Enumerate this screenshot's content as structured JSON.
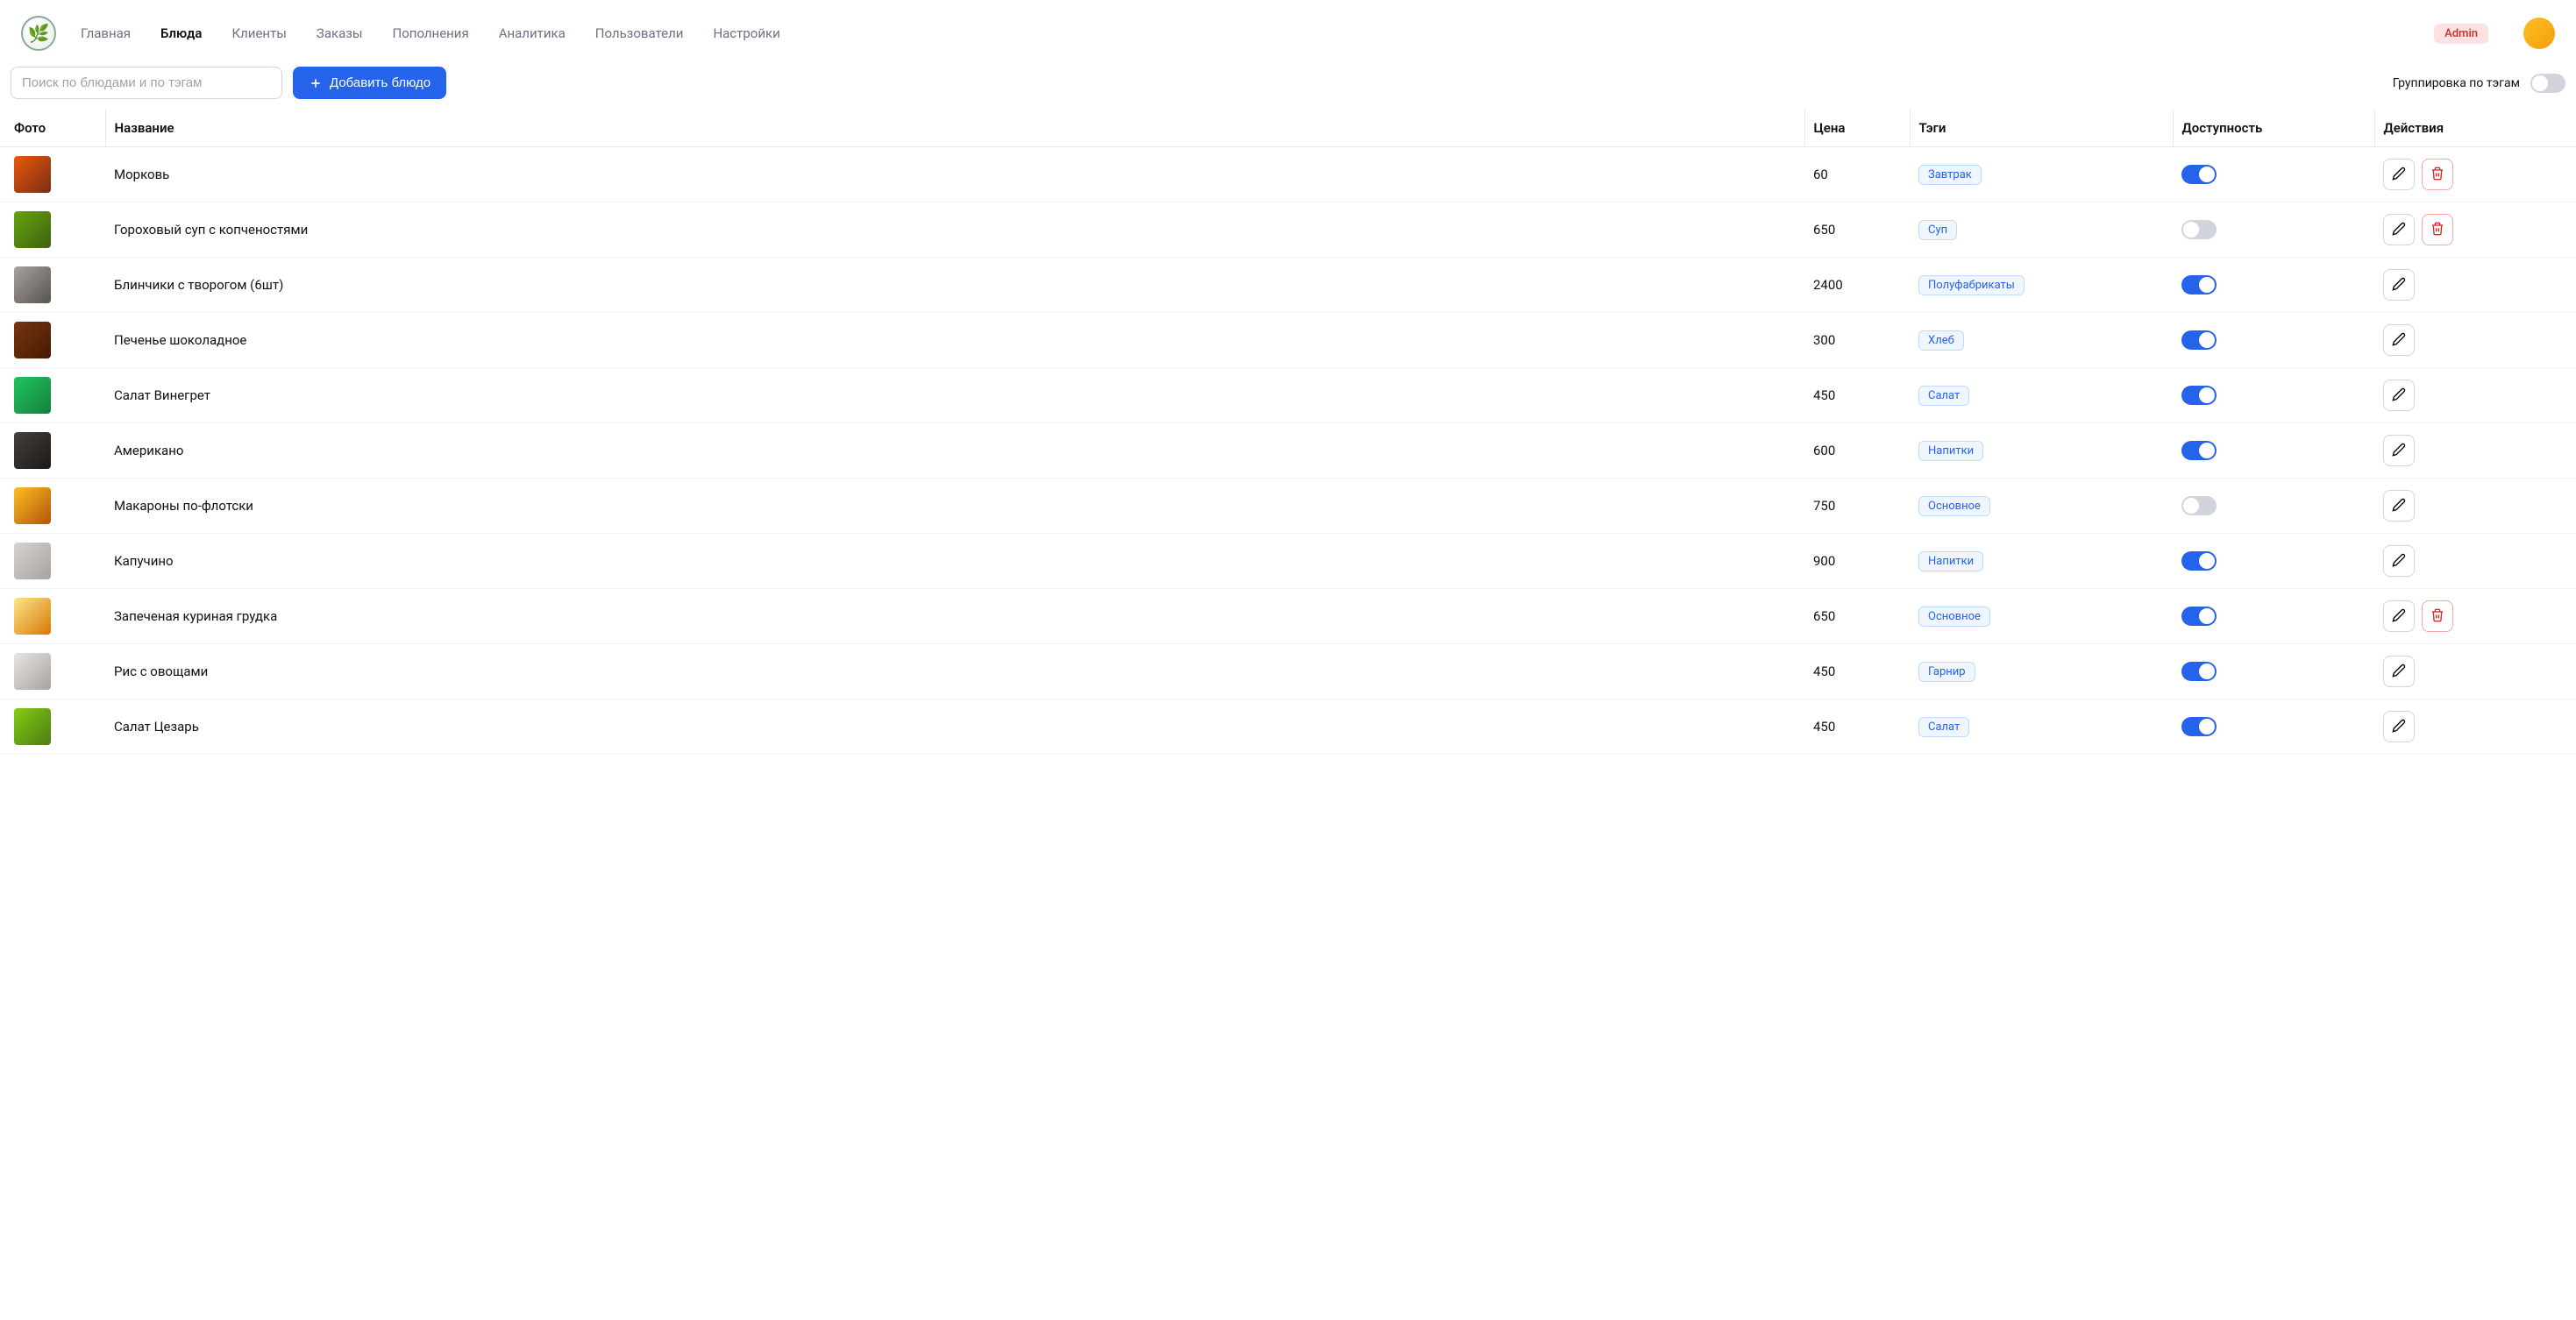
{
  "nav": {
    "items": [
      {
        "label": "Главная",
        "active": false
      },
      {
        "label": "Блюда",
        "active": true
      },
      {
        "label": "Клиенты",
        "active": false
      },
      {
        "label": "Заказы",
        "active": false
      },
      {
        "label": "Пополнения",
        "active": false
      },
      {
        "label": "Аналитика",
        "active": false
      },
      {
        "label": "Пользователи",
        "active": false
      },
      {
        "label": "Настройки",
        "active": false
      }
    ],
    "admin_badge": "Admin"
  },
  "toolbar": {
    "search_placeholder": "Поиск по блюдами и по тэгам",
    "add_label": "Добавить блюдо",
    "group_label": "Группировка по тэгам",
    "group_on": false
  },
  "table": {
    "headers": {
      "photo": "Фото",
      "name": "Название",
      "price": "Цена",
      "tags": "Тэги",
      "availability": "Доступность",
      "actions": "Действия"
    },
    "rows": [
      {
        "name": "Морковь",
        "price": "60",
        "tag": "Завтрак",
        "available": true,
        "deletable": true,
        "thumb": "t1"
      },
      {
        "name": "Гороховый суп с копченостями",
        "price": "650",
        "tag": "Суп",
        "available": false,
        "deletable": true,
        "thumb": "t2"
      },
      {
        "name": "Блинчики с творогом (6шт)",
        "price": "2400",
        "tag": "Полуфабрикаты",
        "available": true,
        "deletable": false,
        "thumb": "t3"
      },
      {
        "name": "Печенье шоколадное",
        "price": "300",
        "tag": "Хлеб",
        "available": true,
        "deletable": false,
        "thumb": "t4"
      },
      {
        "name": "Салат Винегрет",
        "price": "450",
        "tag": "Салат",
        "available": true,
        "deletable": false,
        "thumb": "t5"
      },
      {
        "name": "Американо",
        "price": "600",
        "tag": "Напитки",
        "available": true,
        "deletable": false,
        "thumb": "t6"
      },
      {
        "name": "Макароны по-флотски",
        "price": "750",
        "tag": "Основное",
        "available": false,
        "deletable": false,
        "thumb": "t7"
      },
      {
        "name": "Капучино",
        "price": "900",
        "tag": "Напитки",
        "available": true,
        "deletable": false,
        "thumb": "t8"
      },
      {
        "name": "Запеченая куриная грудка",
        "price": "650",
        "tag": "Основное",
        "available": true,
        "deletable": true,
        "thumb": "t9"
      },
      {
        "name": "Рис с овощами",
        "price": "450",
        "tag": "Гарнир",
        "available": true,
        "deletable": false,
        "thumb": "t10"
      },
      {
        "name": "Салат Цезарь",
        "price": "450",
        "tag": "Салат",
        "available": true,
        "deletable": false,
        "thumb": "t11"
      }
    ]
  }
}
